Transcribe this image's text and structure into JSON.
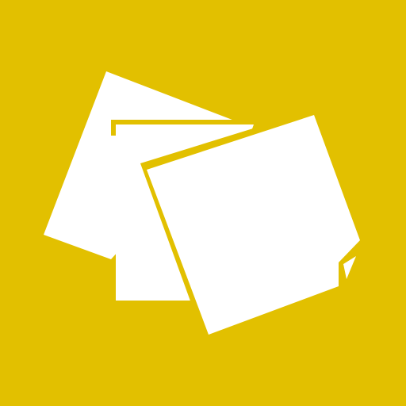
{
  "app_tile": {
    "icon": "sticky-notes-icon",
    "background_color": "#e2c000",
    "foreground_color": "#ffffff"
  }
}
